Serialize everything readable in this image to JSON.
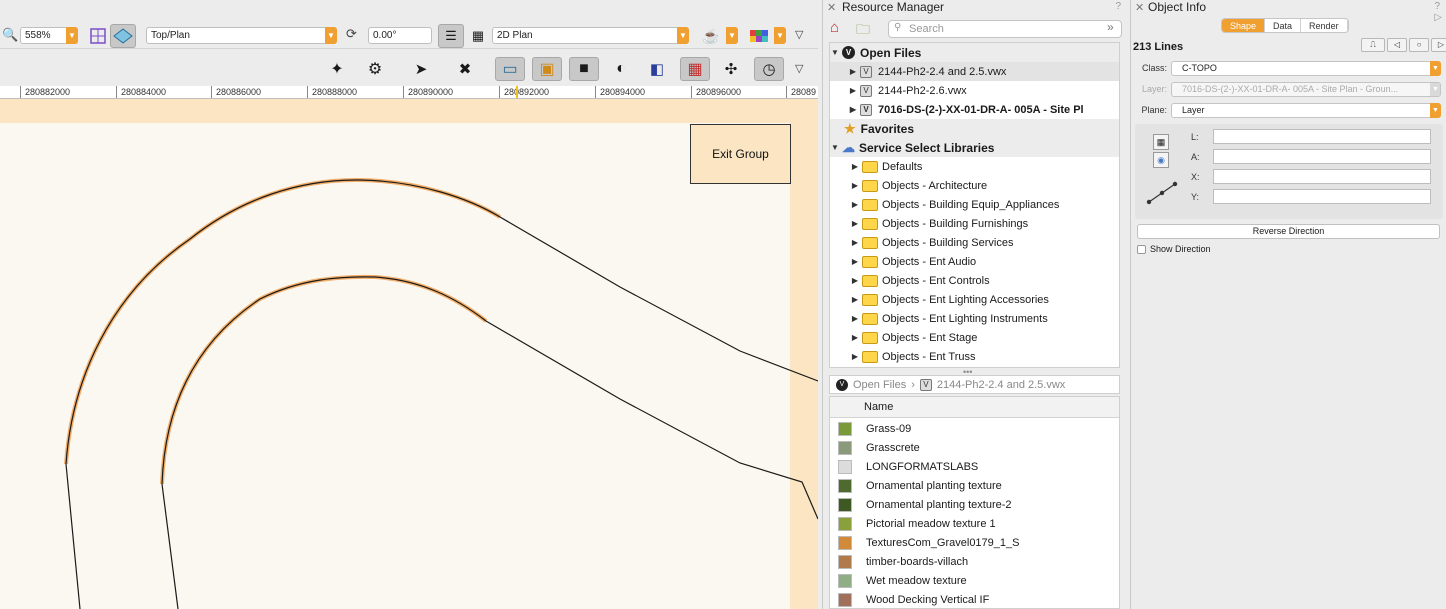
{
  "toolbar1": {
    "zoom": "558%",
    "view": "Top/Plan",
    "rotation": "0.00°",
    "render_mode": "2D Plan"
  },
  "ruler": {
    "labels": [
      "280882000",
      "280884000",
      "280886000",
      "280888000",
      "280890000",
      "280892000",
      "280894000",
      "280896000",
      "28089"
    ]
  },
  "canvas": {
    "exit_group": "Exit Group"
  },
  "resource_manager": {
    "title": "Resource Manager",
    "search_placeholder": "Search",
    "open_files_header": "Open Files",
    "files": [
      "2144-Ph2-2.4 and 2.5.vwx",
      "2144-Ph2-2.6.vwx",
      "7016-DS-(2-)-XX-01-DR-A- 005A - Site Pl"
    ],
    "favorites_header": "Favorites",
    "libraries_header": "Service Select Libraries",
    "folders": [
      "Defaults",
      "Objects - Architecture",
      "Objects - Building Equip_Appliances",
      "Objects - Building Furnishings",
      "Objects - Building Services",
      "Objects - Ent Audio",
      "Objects - Ent Controls",
      "Objects - Ent Lighting Accessories",
      "Objects - Ent Lighting Instruments",
      "Objects - Ent Stage",
      "Objects - Ent Truss"
    ],
    "path_root": "Open Files",
    "path_file": "2144-Ph2-2.4 and 2.5.vwx",
    "list_header": "Name",
    "resources": [
      {
        "name": "Grass-09",
        "color": "#7a9a3a"
      },
      {
        "name": "Grasscrete",
        "color": "#8a9a7a"
      },
      {
        "name": "LONGFORMATSLABS",
        "color": "#dcdcdc"
      },
      {
        "name": "Ornamental planting texture",
        "color": "#4e6a2e"
      },
      {
        "name": "Ornamental planting texture-2",
        "color": "#3e5a22"
      },
      {
        "name": "Pictorial meadow texture 1",
        "color": "#8aa03a"
      },
      {
        "name": "TexturesCom_Gravel0179_1_S",
        "color": "#d08a3a"
      },
      {
        "name": "timber-boards-villach",
        "color": "#b07a4a"
      },
      {
        "name": "Wet meadow texture",
        "color": "#8fae86"
      },
      {
        "name": "Wood Decking Vertical IF",
        "color": "#a0705a"
      }
    ]
  },
  "object_info": {
    "title": "Object Info",
    "tabs": [
      "Shape",
      "Data",
      "Render"
    ],
    "count": "213 Lines",
    "class_label": "Class:",
    "class_value": "C-TOPO",
    "layer_label": "Layer:",
    "layer_value": "7016-DS-(2-)-XX-01-DR-A- 005A - Site Plan - Groun...",
    "plane_label": "Plane:",
    "plane_value": "Layer",
    "field_labels": [
      "L:",
      "A:",
      "X:",
      "Y:"
    ],
    "reverse_button": "Reverse Direction",
    "show_direction": "Show Direction"
  },
  "colors": {
    "accent": "#f0a030",
    "page_border": "#fbe5c2",
    "canvas": "#faf8f0"
  }
}
